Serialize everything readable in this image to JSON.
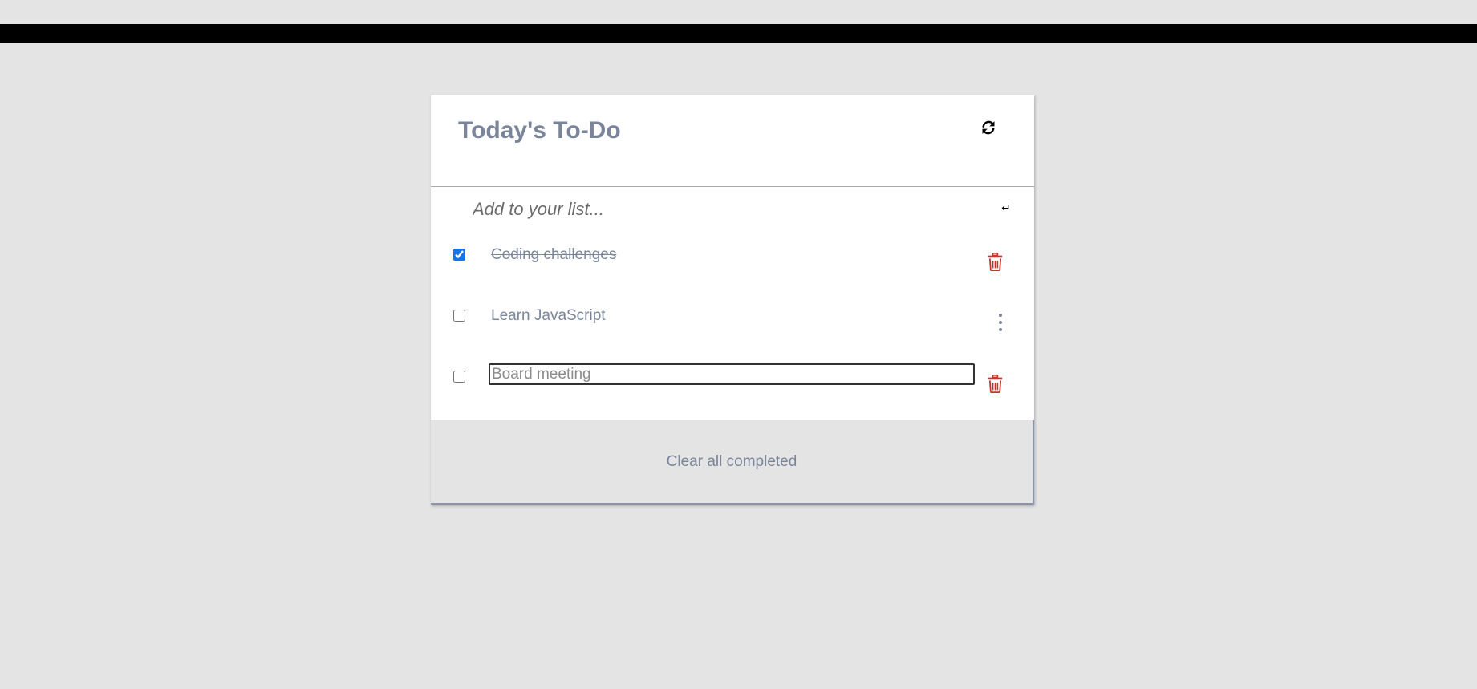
{
  "top_bar": {
    "color": "#000000"
  },
  "card": {
    "title": "Today's To-Do",
    "refresh_icon": "refresh-icon"
  },
  "add_item": {
    "placeholder": "Add to your list...",
    "value": "",
    "enter_icon": "↵"
  },
  "todos": [
    {
      "text": "Coding challenges",
      "completed": true,
      "action": "trash-icon"
    },
    {
      "text": "Learn JavaScript",
      "completed": false,
      "action": "kebab-menu-icon"
    },
    {
      "text": "Board meeting",
      "completed": false,
      "editing": true,
      "action": "trash-icon"
    }
  ],
  "footer": {
    "clear_label": "Clear all completed"
  },
  "colors": {
    "page_background": "#e4e4e4",
    "card_background": "#ffffff",
    "title_text": "#7a8599",
    "trash_icon": "#c0392b",
    "checkbox_accent": "#1a73e8"
  }
}
